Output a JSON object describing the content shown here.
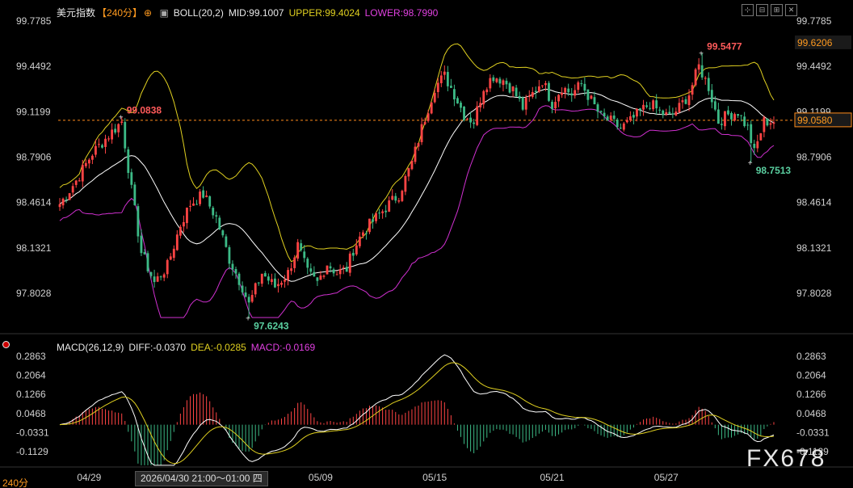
{
  "header": {
    "symbol": "美元指数",
    "period": "【240分】",
    "indicator": "BOLL(20,2)",
    "mid": "MID:99.1007",
    "upper": "UPPER:99.4024",
    "lower": "LOWER:98.7990",
    "macd_title": "MACD(26,12,9)",
    "diff": "DIFF:-0.0370",
    "dea": "DEA:-0.0285",
    "macd_val": "MACD:-0.0169"
  },
  "toolbar": [
    "⊹",
    "⊟",
    "⊞",
    "✕"
  ],
  "period_corner": "240分",
  "cursor_time": "2026/04/30 21:00～01:00 四",
  "watermark": "FX678",
  "colors": {
    "up": "#ff4444",
    "down": "#3cba86",
    "mid": "#ffffff",
    "upper": "#e0d020",
    "lower": "#d030d0",
    "dea": "#e0d020",
    "diff": "#ffffff",
    "price_line": "#ff8c1a",
    "axis_text": "#d0d0d0"
  },
  "chart_data": {
    "type": "candlestick",
    "title": "",
    "price_axis": {
      "ticks": [
        99.7785,
        99.4492,
        99.1199,
        98.7906,
        98.4614,
        98.1321,
        97.8028
      ],
      "range": [
        97.5,
        99.85
      ]
    },
    "macd_axis": {
      "ticks": [
        0.2863,
        0.2064,
        0.1266,
        0.0468,
        -0.0331,
        -0.1129
      ],
      "range": [
        -0.17,
        0.32
      ]
    },
    "x_labels": [
      "04/29",
      "05/09",
      "05/15",
      "05/21",
      "05/27"
    ],
    "x_label_bars": [
      9,
      80,
      115,
      151,
      186
    ],
    "current_price": 99.058,
    "upper_badge": 99.6206,
    "annotations": [
      {
        "label": "99.0838",
        "bar": 19,
        "value": 99.0838,
        "kind": "high"
      },
      {
        "label": "97.6243",
        "bar": 58,
        "value": 97.6243,
        "kind": "low"
      },
      {
        "label": "99.5477",
        "bar": 197,
        "value": 99.5477,
        "kind": "high"
      },
      {
        "label": "98.7513",
        "bar": 212,
        "value": 98.7513,
        "kind": "low"
      }
    ],
    "anchors": [
      [
        0,
        98.45
      ],
      [
        5,
        98.62
      ],
      [
        10,
        98.82
      ],
      [
        15,
        98.95
      ],
      [
        19,
        99.05
      ],
      [
        22,
        98.55
      ],
      [
        25,
        98.1
      ],
      [
        29,
        97.88
      ],
      [
        33,
        98.0
      ],
      [
        37,
        98.3
      ],
      [
        40,
        98.45
      ],
      [
        44,
        98.52
      ],
      [
        48,
        98.35
      ],
      [
        52,
        98.05
      ],
      [
        56,
        97.85
      ],
      [
        58,
        97.72
      ],
      [
        62,
        97.95
      ],
      [
        66,
        97.85
      ],
      [
        70,
        97.95
      ],
      [
        73,
        98.15
      ],
      [
        76,
        97.95
      ],
      [
        79,
        97.88
      ],
      [
        82,
        98.02
      ],
      [
        85,
        97.95
      ],
      [
        88,
        97.98
      ],
      [
        90,
        98.12
      ],
      [
        93,
        98.25
      ],
      [
        97,
        98.35
      ],
      [
        101,
        98.45
      ],
      [
        104,
        98.52
      ],
      [
        108,
        98.75
      ],
      [
        111,
        99.0
      ],
      [
        115,
        99.3
      ],
      [
        118,
        99.38
      ],
      [
        121,
        99.25
      ],
      [
        124,
        99.1
      ],
      [
        127,
        99.05
      ],
      [
        130,
        99.3
      ],
      [
        133,
        99.38
      ],
      [
        136,
        99.35
      ],
      [
        139,
        99.28
      ],
      [
        142,
        99.15
      ],
      [
        145,
        99.25
      ],
      [
        148,
        99.35
      ],
      [
        151,
        99.18
      ],
      [
        154,
        99.3
      ],
      [
        157,
        99.25
      ],
      [
        160,
        99.32
      ],
      [
        163,
        99.2
      ],
      [
        166,
        99.08
      ],
      [
        169,
        99.05
      ],
      [
        172,
        99.0
      ],
      [
        175,
        99.05
      ],
      [
        178,
        99.12
      ],
      [
        181,
        99.18
      ],
      [
        184,
        99.12
      ],
      [
        187,
        99.08
      ],
      [
        190,
        99.15
      ],
      [
        193,
        99.25
      ],
      [
        196,
        99.45
      ],
      [
        199,
        99.3
      ],
      [
        202,
        99.05
      ],
      [
        205,
        99.1
      ],
      [
        208,
        99.12
      ],
      [
        211,
        99.0
      ],
      [
        213,
        98.82
      ],
      [
        216,
        99.05
      ],
      [
        219,
        99.05
      ]
    ],
    "bar_count": 220,
    "bollinger": {
      "period": 20,
      "k": 2
    },
    "macd": {
      "fast": 12,
      "slow": 26,
      "signal": 9
    }
  }
}
